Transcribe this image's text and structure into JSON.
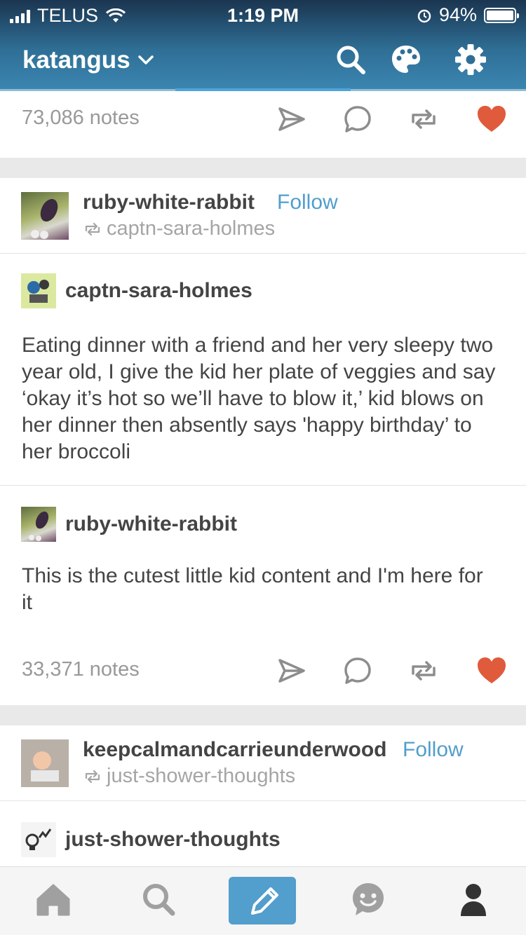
{
  "status_bar": {
    "carrier": "TELUS",
    "time": "1:19 PM",
    "battery": "94%"
  },
  "header": {
    "blog_name": "katangus"
  },
  "top_post": {
    "notes": "73,086 notes"
  },
  "post": {
    "reblogger": "ruby-white-rabbit",
    "follow_label": "Follow",
    "reblogged_from": "captn-sara-holmes",
    "entries": [
      {
        "author": "captn-sara-holmes",
        "text": "Eating dinner with a friend and her very sleepy two year old, I give the kid her plate of veggies and say ‘okay it’s hot so we’ll have to blow it,’ kid blows on her dinner then absently says 'happy birthday’ to her broccoli"
      },
      {
        "author": "ruby-white-rabbit",
        "text": "This is the cutest little kid content and I'm here for it"
      }
    ],
    "notes": "33,371 notes"
  },
  "next_post": {
    "reblogger": "keepcalmandcarrieunderwood",
    "follow_label": "Follow",
    "reblogged_from": "just-shower-thoughts",
    "author": "just-shower-thoughts"
  },
  "colors": {
    "accent": "#529ecc",
    "like": "#e05a3c",
    "header_top": "#1b3550",
    "header_bottom": "#3b87b2"
  },
  "icons": [
    "search-icon",
    "palette-icon",
    "gear-icon",
    "send-icon",
    "reply-icon",
    "reblog-icon",
    "heart-icon",
    "home-icon",
    "explore-icon",
    "compose-icon",
    "messaging-icon",
    "account-icon"
  ]
}
